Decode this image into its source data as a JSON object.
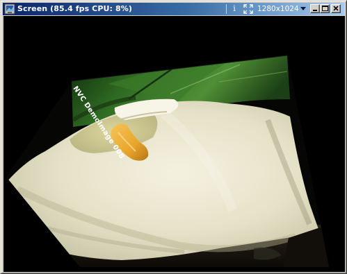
{
  "window": {
    "title": "Screen (85.4 fps  CPU: 8%)",
    "resolution": "1280x1024",
    "icons": {
      "app": "app-icon",
      "info": "info-icon",
      "fullscreen": "fullscreen-icon",
      "resolution_dropdown": "chevron-down-icon",
      "minimize": "minimize-icon",
      "maximize": "maximize-icon",
      "close": "close-icon"
    },
    "colors": {
      "titlebar_start": "#0a246a",
      "titlebar_end": "#a6caf0",
      "chrome": "#d4d0c8"
    }
  },
  "screen": {
    "image_subject": "calla lily flower",
    "overlay_text": "NVC DemoImage 008"
  }
}
